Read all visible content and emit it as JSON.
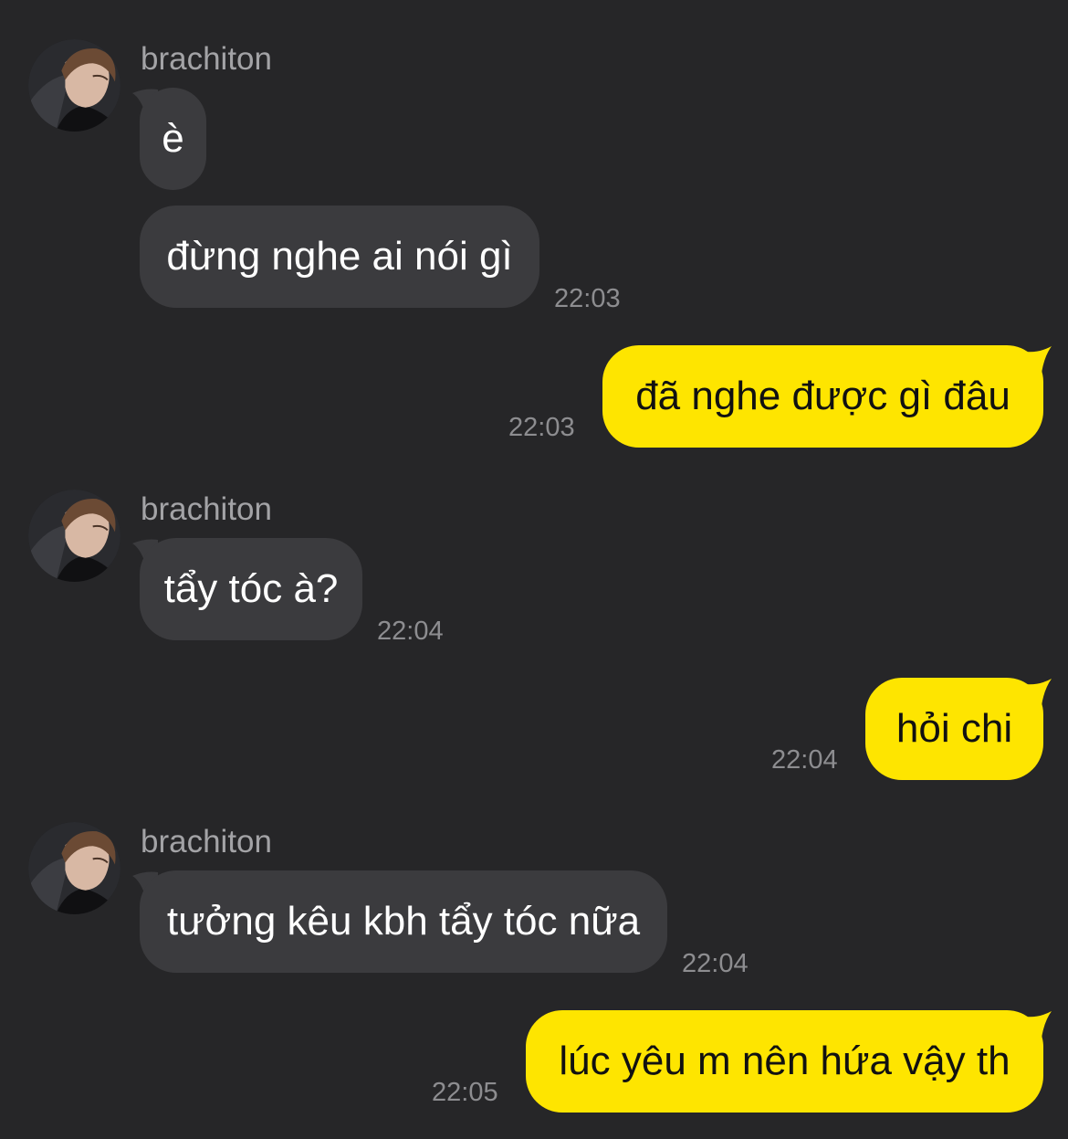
{
  "conversation": {
    "contact_name": "brachiton",
    "contact_avatar_icon": "profile-photo",
    "colors": {
      "background": "#262628",
      "incoming_bubble": "#3b3b3e",
      "outgoing_bubble": "#fee500",
      "timestamp": "#8d8d90",
      "sender_name": "#a3a3a6"
    },
    "groups": [
      {
        "sender": "brachiton",
        "direction": "incoming",
        "messages": [
          {
            "text": "è",
            "time": ""
          },
          {
            "text": "đừng nghe ai nói gì",
            "time": "22:03"
          }
        ]
      },
      {
        "sender": "",
        "direction": "outgoing",
        "messages": [
          {
            "text": "đã nghe được gì đâu",
            "time": "22:03"
          }
        ]
      },
      {
        "sender": "brachiton",
        "direction": "incoming",
        "messages": [
          {
            "text": "tẩy tóc à?",
            "time": "22:04"
          }
        ]
      },
      {
        "sender": "",
        "direction": "outgoing",
        "messages": [
          {
            "text": "hỏi chi",
            "time": "22:04"
          }
        ]
      },
      {
        "sender": "brachiton",
        "direction": "incoming",
        "messages": [
          {
            "text": "tưởng kêu kbh tẩy tóc nữa",
            "time": "22:04"
          }
        ]
      },
      {
        "sender": "",
        "direction": "outgoing",
        "messages": [
          {
            "text": "lúc yêu m nên hứa vậy th",
            "time": "22:05"
          }
        ]
      }
    ]
  }
}
